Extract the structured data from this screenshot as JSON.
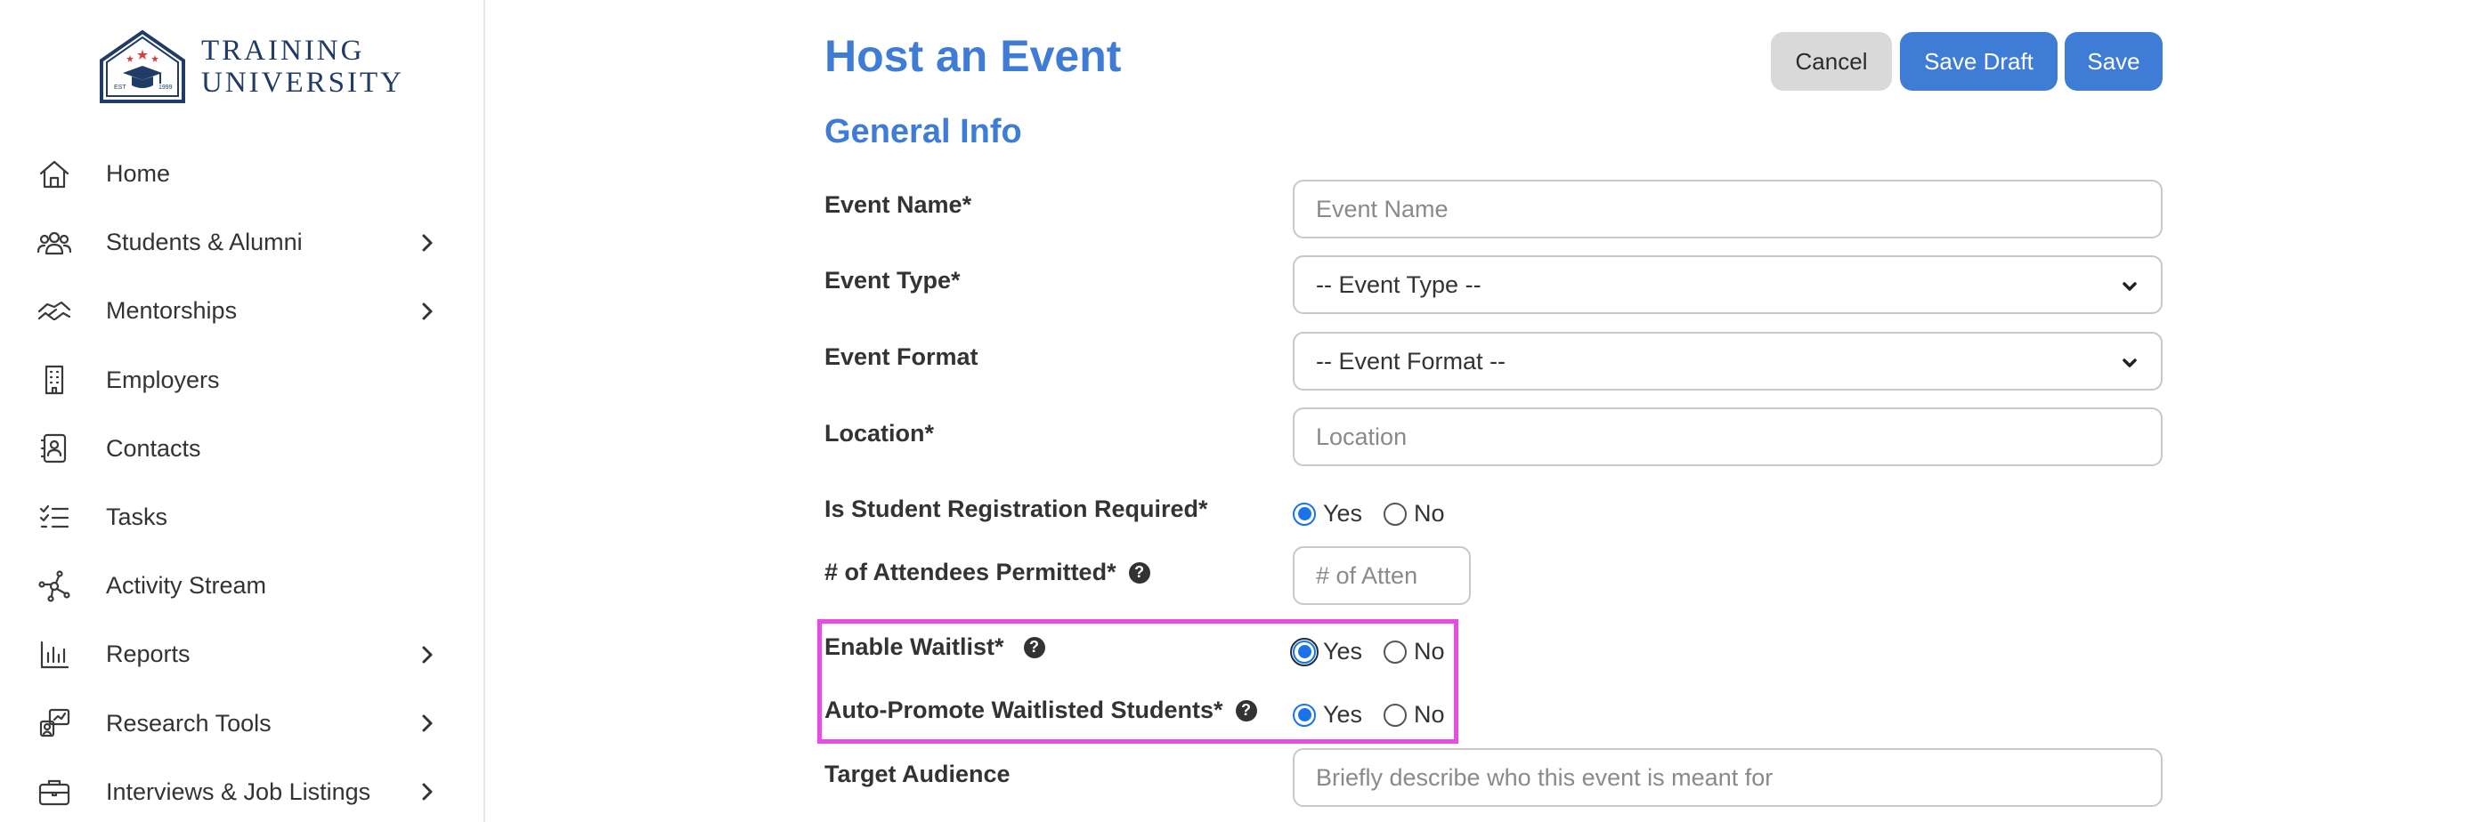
{
  "brand": {
    "line1": "TRAINING",
    "line2": "UNIVERSITY",
    "est_left": "EST",
    "est_right": "1999"
  },
  "sidebar": {
    "items": [
      {
        "label": "Home",
        "icon": "home-icon",
        "chevron": false
      },
      {
        "label": "Students & Alumni",
        "icon": "users-icon",
        "chevron": true
      },
      {
        "label": "Mentorships",
        "icon": "handshake-icon",
        "chevron": true
      },
      {
        "label": "Employers",
        "icon": "building-icon",
        "chevron": false
      },
      {
        "label": "Contacts",
        "icon": "contact-book-icon",
        "chevron": false
      },
      {
        "label": "Tasks",
        "icon": "checklist-icon",
        "chevron": false
      },
      {
        "label": "Activity Stream",
        "icon": "network-icon",
        "chevron": false
      },
      {
        "label": "Reports",
        "icon": "bar-chart-icon",
        "chevron": true
      },
      {
        "label": "Research Tools",
        "icon": "research-icon",
        "chevron": true
      },
      {
        "label": "Interviews & Job Listings",
        "icon": "briefcase-icon",
        "chevron": true
      }
    ]
  },
  "header": {
    "title": "Host an Event",
    "cancel_label": "Cancel",
    "save_draft_label": "Save Draft",
    "save_label": "Save"
  },
  "section": {
    "title": "General Info"
  },
  "form": {
    "event_name": {
      "label": "Event Name*",
      "placeholder": "Event Name",
      "value": ""
    },
    "event_type": {
      "label": "Event Type*",
      "selected": "-- Event Type --"
    },
    "event_format": {
      "label": "Event Format",
      "selected": "-- Event Format --"
    },
    "location": {
      "label": "Location*",
      "placeholder": "Location",
      "value": ""
    },
    "registration_required": {
      "label": "Is Student Registration Required*",
      "yes": "Yes",
      "no": "No",
      "value": "Yes"
    },
    "attendees": {
      "label": "# of Attendees Permitted*",
      "placeholder": "# of Atten",
      "value": ""
    },
    "enable_waitlist": {
      "label": "Enable Waitlist*",
      "yes": "Yes",
      "no": "No",
      "value": "Yes"
    },
    "auto_promote": {
      "label": "Auto-Promote Waitlisted Students*",
      "yes": "Yes",
      "no": "No",
      "value": "Yes"
    },
    "target_audience": {
      "label": "Target Audience",
      "placeholder": "Briefly describe who this event is meant for",
      "value": ""
    }
  },
  "colors": {
    "accent": "#3f7cd6",
    "highlight": "#e94be6",
    "radio": "#1a73e8"
  }
}
